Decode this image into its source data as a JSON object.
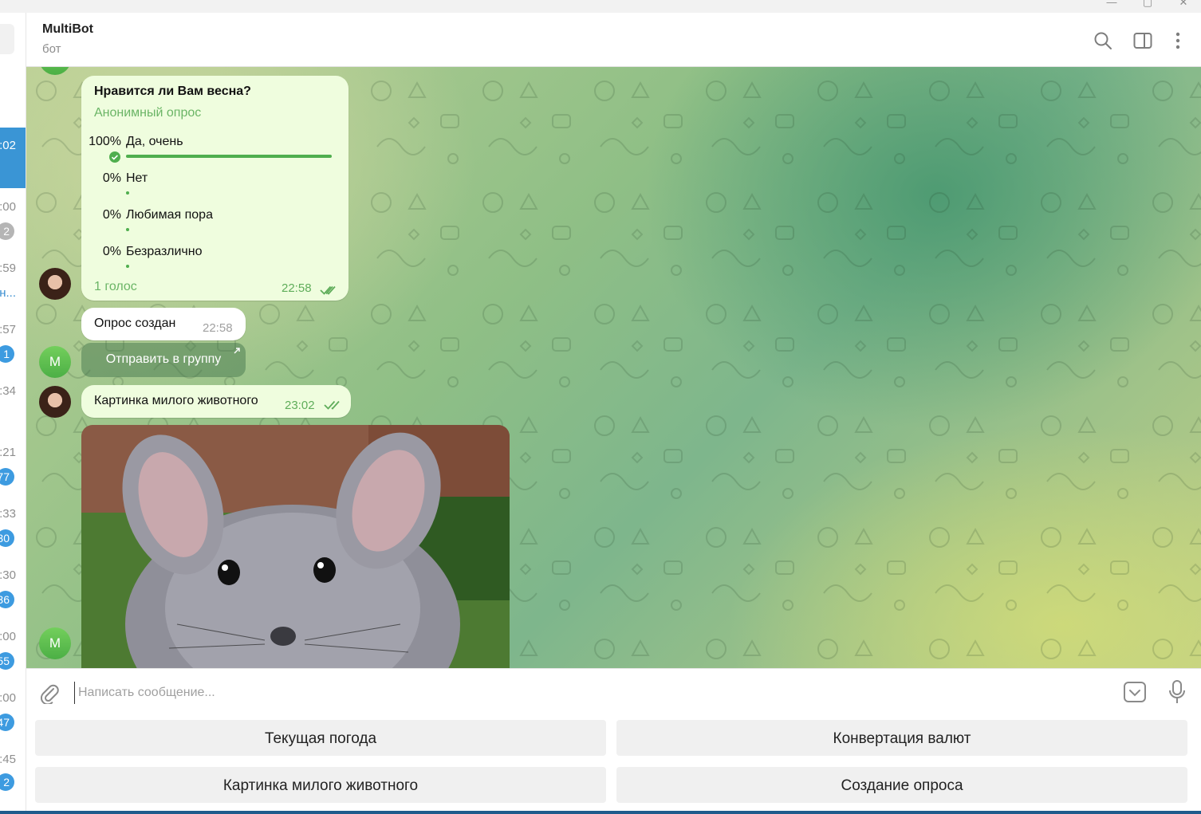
{
  "window": {
    "minimize_glyph": "—",
    "maximize_glyph": "▢",
    "close_glyph": "✕"
  },
  "sidebar": {
    "times": [
      ":02",
      ":00",
      ":59",
      ":57",
      ":34",
      ":21",
      ":33",
      ":30",
      ":00",
      ":00",
      ":45"
    ],
    "badges": [
      "2",
      "1",
      "77",
      "30",
      "36",
      "55",
      "47",
      "2"
    ],
    "preview_link": "н..."
  },
  "header": {
    "title": "MultiBot",
    "subtitle": "бот",
    "icons": [
      "search-icon",
      "sidebar-toggle-icon",
      "more-vertical-icon"
    ]
  },
  "messages": {
    "poll": {
      "question": "Нравится ли Вам весна?",
      "type": "Анонимный опрос",
      "options": [
        {
          "pct": "100%",
          "label": "Да, очень",
          "fill": 1.0,
          "chosen": true
        },
        {
          "pct": "0%",
          "label": "Нет",
          "fill": 0.0,
          "chosen": false
        },
        {
          "pct": "0%",
          "label": "Любимая пора",
          "fill": 0.0,
          "chosen": false
        },
        {
          "pct": "0%",
          "label": "Безразлично",
          "fill": 0.0,
          "chosen": false
        }
      ],
      "votes": "1 голос",
      "time": "22:58"
    },
    "created": {
      "text": "Опрос создан",
      "time": "22:58",
      "inline_button": "Отправить в группу"
    },
    "request": {
      "text": "Картинка милого животного",
      "time": "23:02"
    },
    "bot_avatar_letter": "M"
  },
  "composer": {
    "placeholder": "Написать сообщение..."
  },
  "keyboard": {
    "buttons": [
      "Текущая погода",
      "Конвертация валют",
      "Картинка милого животного",
      "Создание опроса"
    ]
  },
  "colors": {
    "accent": "#3a95d5",
    "bubble_out": "#effdde",
    "poll_bar": "#4fae4e",
    "kb_button": "#f0f0f0"
  }
}
